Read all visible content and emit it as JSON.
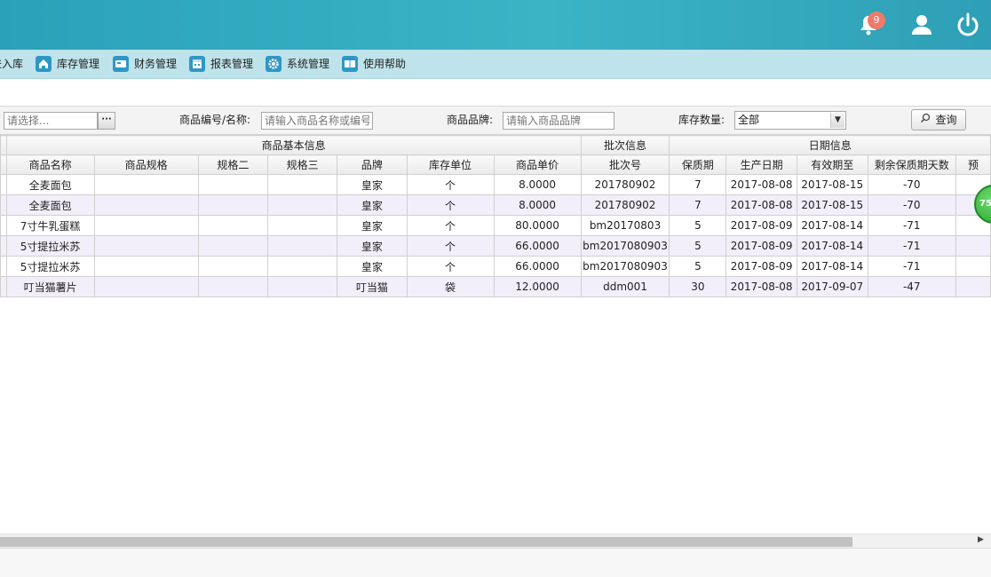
{
  "header": {
    "notification_count": "9"
  },
  "menu": [
    {
      "label": "进入库",
      "icon": "inbox-icon"
    },
    {
      "label": "库存管理",
      "icon": "home-icon"
    },
    {
      "label": "财务管理",
      "icon": "card-icon"
    },
    {
      "label": "报表管理",
      "icon": "calendar-icon"
    },
    {
      "label": "系统管理",
      "icon": "gear-icon"
    },
    {
      "label": "使用帮助",
      "icon": "book-icon"
    }
  ],
  "filters": {
    "selector_placeholder": "请选择...",
    "code_name_label": "商品编号/名称:",
    "code_name_placeholder": "请输入商品名称或编号",
    "brand_label": "商品品牌:",
    "brand_placeholder": "请输入商品品牌",
    "stock_label": "库存数量:",
    "stock_value": "全部",
    "query_label": "查询"
  },
  "table": {
    "group_headers": [
      "商品基本信息",
      "批次信息",
      "日期信息"
    ],
    "columns": [
      "商品名称",
      "商品规格",
      "规格二",
      "规格三",
      "品牌",
      "库存单位",
      "商品单价",
      "批次号",
      "保质期",
      "生产日期",
      "有效期至",
      "剩余保质期天数",
      "预"
    ],
    "rows": [
      [
        "全麦面包",
        "",
        "",
        "",
        "皇家",
        "个",
        "8.0000",
        "201780902",
        "7",
        "2017-08-08",
        "2017-08-15",
        "-70",
        ""
      ],
      [
        "全麦面包",
        "",
        "",
        "",
        "皇家",
        "个",
        "8.0000",
        "201780902",
        "7",
        "2017-08-08",
        "2017-08-15",
        "-70",
        ""
      ],
      [
        "7寸牛乳蛋糕",
        "",
        "",
        "",
        "皇家",
        "个",
        "80.0000",
        "bm20170803",
        "5",
        "2017-08-09",
        "2017-08-14",
        "-71",
        ""
      ],
      [
        "5寸提拉米苏",
        "",
        "",
        "",
        "皇家",
        "个",
        "66.0000",
        "bm2017080903",
        "5",
        "2017-08-09",
        "2017-08-14",
        "-71",
        ""
      ],
      [
        "5寸提拉米苏",
        "",
        "",
        "",
        "皇家",
        "个",
        "66.0000",
        "bm2017080903",
        "5",
        "2017-08-09",
        "2017-08-14",
        "-71",
        ""
      ],
      [
        "叮当猫薯片",
        "",
        "",
        "",
        "叮当猫",
        "袋",
        "12.0000",
        "ddm001",
        "30",
        "2017-08-08",
        "2017-09-07",
        "-47",
        ""
      ]
    ]
  },
  "floating_badge": "75"
}
